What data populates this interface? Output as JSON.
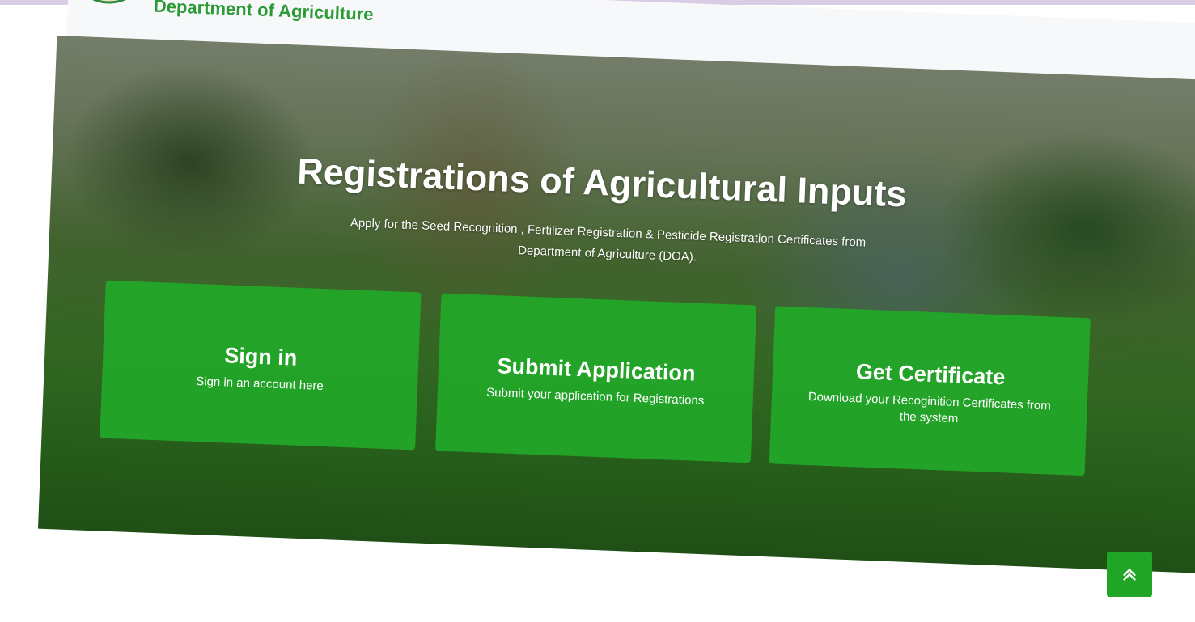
{
  "header": {
    "department_name": "Department of Agriculture",
    "logo_icon": "government-seal-icon"
  },
  "hero": {
    "title": "Registrations of Agricultural Inputs",
    "subtitle": "Apply for the Seed Recognition , Fertilizer Registration & Pesticide Registration Certificates from Department of Agriculture (DOA)."
  },
  "cards": [
    {
      "title": "Sign in",
      "description": "Sign in an account here"
    },
    {
      "title": "Submit Application",
      "description": "Submit your application for Registrations"
    },
    {
      "title": "Get Certificate",
      "description": "Download your Recoginition Certificates from the system"
    }
  ],
  "scroll_top": {
    "icon": "double-chevron-up-icon"
  },
  "colors": {
    "brand_green": "#2c9a36",
    "card_green": "#22a828",
    "button_green": "#21a526",
    "top_strip": "#d9cde6"
  }
}
